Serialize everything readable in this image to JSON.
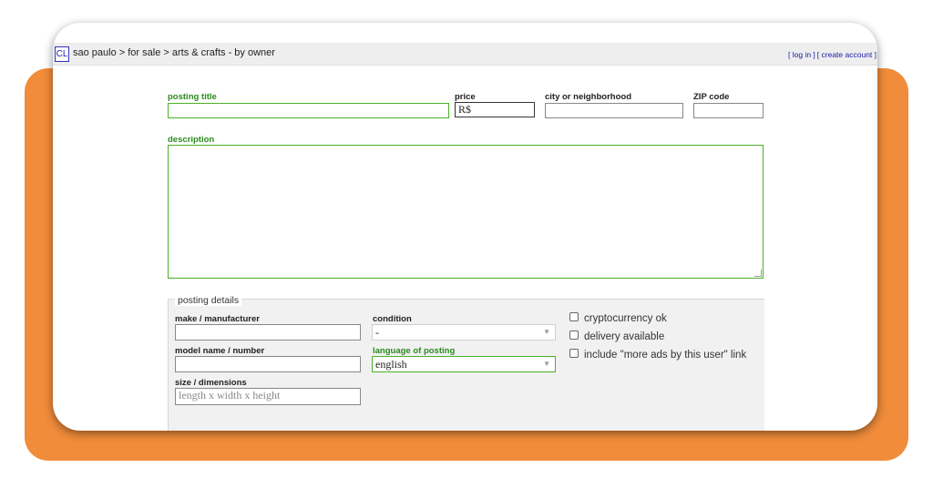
{
  "header": {
    "logo": "CL",
    "breadcrumb": "sao paulo > for sale > arts & crafts - by owner",
    "login": "[ log in ]",
    "create_account": "[ create account ]"
  },
  "form": {
    "posting_title_label": "posting title",
    "price_label": "price",
    "price_value": "R$",
    "city_label": "city or neighborhood",
    "zip_label": "ZIP code",
    "description_label": "description"
  },
  "details": {
    "legend": "posting details",
    "make_label": "make / manufacturer",
    "model_label": "model name / number",
    "size_label": "size / dimensions",
    "size_placeholder": "length x width x height",
    "condition_label": "condition",
    "condition_value": "-",
    "language_label": "language of posting",
    "language_value": "english",
    "crypto": "cryptocurrency ok",
    "delivery": "delivery available",
    "more_ads": "include \"more ads by this user\" link"
  },
  "colors": {
    "accent_orange": "#f08c3a",
    "required_green": "#2b8a1f"
  }
}
